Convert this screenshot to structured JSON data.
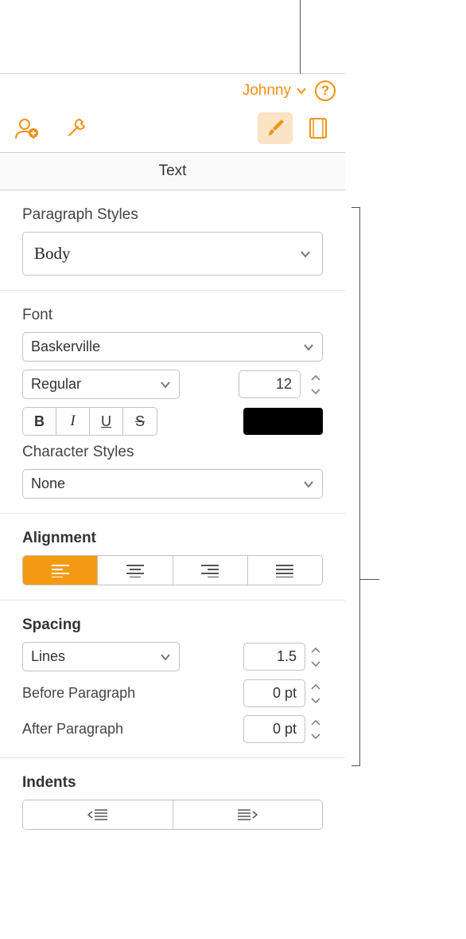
{
  "header": {
    "user": "Johnny"
  },
  "panel_title": "Text",
  "paragraph_styles": {
    "label": "Paragraph Styles",
    "value": "Body"
  },
  "font": {
    "label": "Font",
    "family": "Baskerville",
    "weight": "Regular",
    "size": "12",
    "char_styles_label": "Character Styles",
    "char_styles_value": "None"
  },
  "alignment": {
    "label": "Alignment"
  },
  "spacing": {
    "label": "Spacing",
    "mode": "Lines",
    "value": "1.5",
    "before_label": "Before Paragraph",
    "before_value": "0 pt",
    "after_label": "After Paragraph",
    "after_value": "0 pt"
  },
  "indents": {
    "label": "Indents"
  }
}
